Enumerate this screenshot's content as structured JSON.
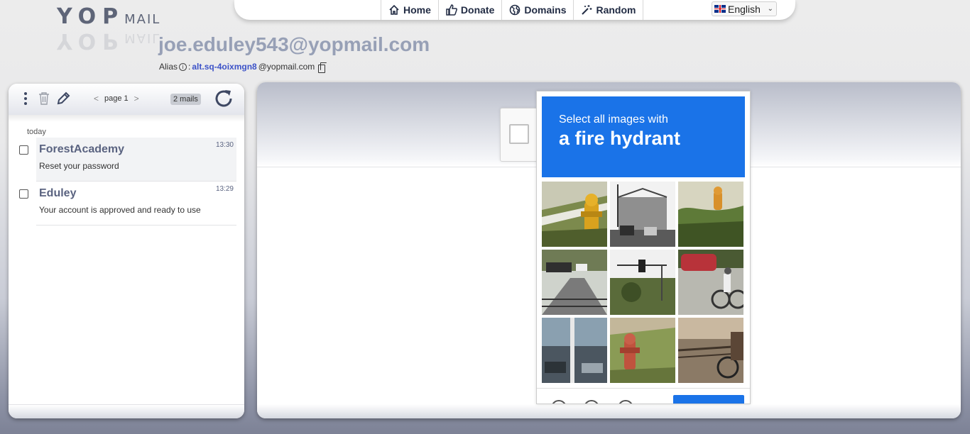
{
  "logo": {
    "prefix": "YOP",
    "suffix": "MAIL"
  },
  "nav": {
    "items": [
      {
        "label": "Home",
        "icon": "home-icon"
      },
      {
        "label": "Donate",
        "icon": "thumbs-up-icon"
      },
      {
        "label": "Domains",
        "icon": "globe-icon"
      },
      {
        "label": "Random",
        "icon": "magic-wand-icon"
      }
    ],
    "language": "English"
  },
  "inbox": {
    "email": "joe.eduley543@yopmail.com",
    "alias_label": "Alias",
    "alias_sep": ":",
    "alias_value": "alt.sq-4oixmgn8",
    "alias_domain": "@yopmail.com"
  },
  "toolbar": {
    "page_label": "page 1",
    "mail_count": "2 mails"
  },
  "mail_list": {
    "group_label": "today",
    "mails": [
      {
        "from": "ForestAcademy",
        "subject": "Reset your password",
        "time": "13:30",
        "selected": true
      },
      {
        "from": "Eduley",
        "subject": "Your account is approved and ready to use",
        "time": "13:29",
        "selected": false
      }
    ]
  },
  "captcha": {
    "instruction": "Select all images with",
    "target": "a fire hydrant",
    "tiles": [
      "fire-hydrant-on-grass",
      "street-with-cars-and-bridge",
      "fire-hydrant-in-bushes",
      "road-with-signs",
      "traffic-light-and-trees",
      "cyclist-near-red-car",
      "street-with-pole",
      "red-fire-hydrant-in-grass",
      "bicycle-near-wall"
    ]
  },
  "colors": {
    "accent_blue": "#1a73e8",
    "brand_text": "#97a0b6",
    "nav_text": "#222c44",
    "alias_link": "#3c52c8"
  }
}
